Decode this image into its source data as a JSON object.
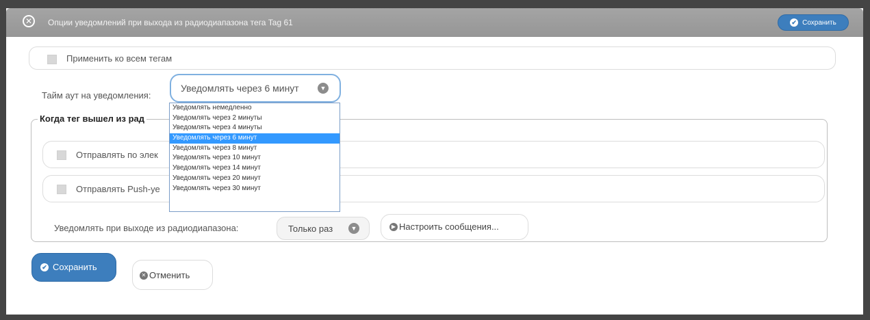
{
  "dialog": {
    "title": "Опции уведомлений при выхода из радиодиапазона тега Tag 61",
    "header_save_label": "Сохранить"
  },
  "apply_all_label": "Применить ко всем тегам",
  "timeout": {
    "label": "Тайм аут на уведомления:",
    "selected_value": "Уведомлять через 6 минут",
    "options": [
      "Уведомлять немедленно",
      "Уведомлять через 2 минуты",
      "Уведомлять через 4 минуты",
      "Уведомлять через 6 минут",
      "Уведомлять через 8 минут",
      "Уведомлять через 10 минут",
      "Уведомлять через 14 минут",
      "Уведомлять через 20 минут",
      "Уведомлять через 30 минут"
    ],
    "selected_index": 3
  },
  "section": {
    "legend": "Когда тег вышел из рад",
    "email_label": "Отправлять по элек",
    "push_label": "Отправлять Push-уе",
    "notify_label": "Уведомлять при выходе из радиодиапазона:",
    "notify_value": "Только раз",
    "configure_label": "Настроить сообщения..."
  },
  "footer": {
    "save_label": "Сохранить",
    "cancel_label": "Отменить"
  },
  "colors": {
    "accent": "#3d7ebd",
    "titlebar": "#9e9e9e",
    "selection": "#3399ff"
  }
}
